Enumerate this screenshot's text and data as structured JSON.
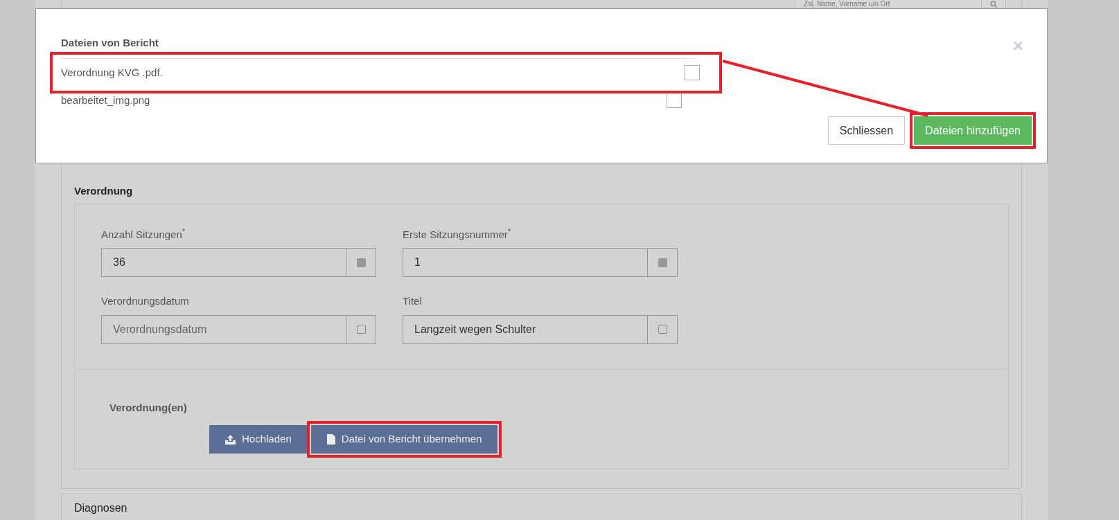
{
  "header": {
    "search": {
      "placeholder": "Zsl, Name, Vorname u/o Ort"
    }
  },
  "dialog": {
    "title": "Dateien von Bericht",
    "close": "×",
    "files": [
      {
        "name": "Verordnung KVG .pdf.",
        "checked": false,
        "highlighted": true
      },
      {
        "name": "bearbeitet_img.png",
        "checked": false,
        "highlighted": false
      }
    ],
    "buttons": [
      {
        "label": "Schliessen",
        "kind": "default",
        "highlighted": false
      },
      {
        "label": "Dateien hinzufügen",
        "kind": "primary",
        "highlighted": true
      }
    ]
  },
  "section": {
    "title": "Verordnung",
    "fields": [
      {
        "label": "Anzahl Sitzungen$^{*}$",
        "value": "36",
        "kind": "filled"
      },
      {
        "label": "Erste Sitzungsnummer$^{*}$",
        "value": "1",
        "kind": "filled"
      },
      {
        "label": "Verordnungsdatum",
        "placeholder": "Verordnungsdatum",
        "kind": "outline"
      },
      {
        "label": "Titel",
        "value": "Langzeit wegen Schulter",
        "kind": "outline"
      }
    ],
    "attachments_label": "Verordnung(en)",
    "buttons": [
      {
        "label": "Hochladen",
        "kind": "upload",
        "highlighted": false
      },
      {
        "label": "Datei von Bericht übernehmen",
        "kind": "file",
        "highlighted": true
      }
    ]
  },
  "next_section": {
    "title": "Diagnosen"
  }
}
